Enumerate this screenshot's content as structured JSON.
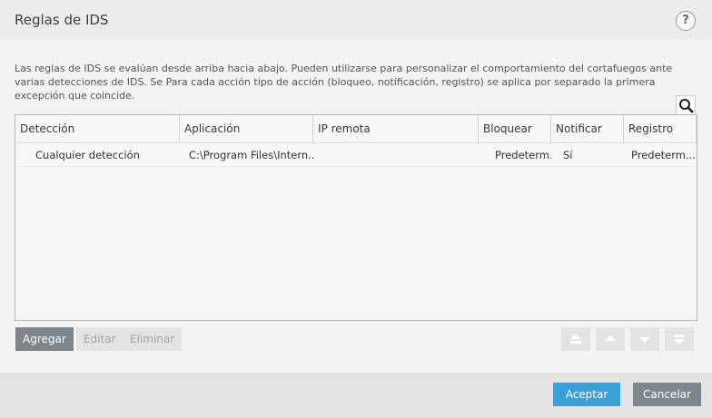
{
  "window": {
    "title": "Reglas de IDS",
    "help_label": "?"
  },
  "description": "Las reglas de IDS se evalúan desde arriba hacia abajo. Pueden utilizarse para personalizar el comportamiento del cortafuegos ante varias detecciones de IDS. Se Para cada acción tipo de acción (bloqueo, notificación, registro) se aplica por separado la primera excepción que coincide.",
  "search": {
    "icon": "search-icon"
  },
  "table": {
    "columns": [
      "Detección",
      "Aplicación",
      "IP remota",
      "Bloquear",
      "Notificar",
      "Registro"
    ],
    "rows": [
      [
        "Cualquier detección",
        "C:\\Program Files\\Intern...",
        "",
        "Predeterm...",
        "Sí",
        "Predeterm..."
      ]
    ]
  },
  "actions": {
    "add": "Agregar",
    "edit": "Editar",
    "delete": "Eliminar"
  },
  "move_buttons": [
    "move-top-icon",
    "move-up-icon",
    "move-down-icon",
    "move-bottom-icon"
  ],
  "footer": {
    "ok": "Aceptar",
    "cancel": "Cancelar"
  },
  "colors": {
    "accent": "#3a9fd6",
    "neutral_button": "#7e868c",
    "disabled_button": "#e3e3e3"
  }
}
